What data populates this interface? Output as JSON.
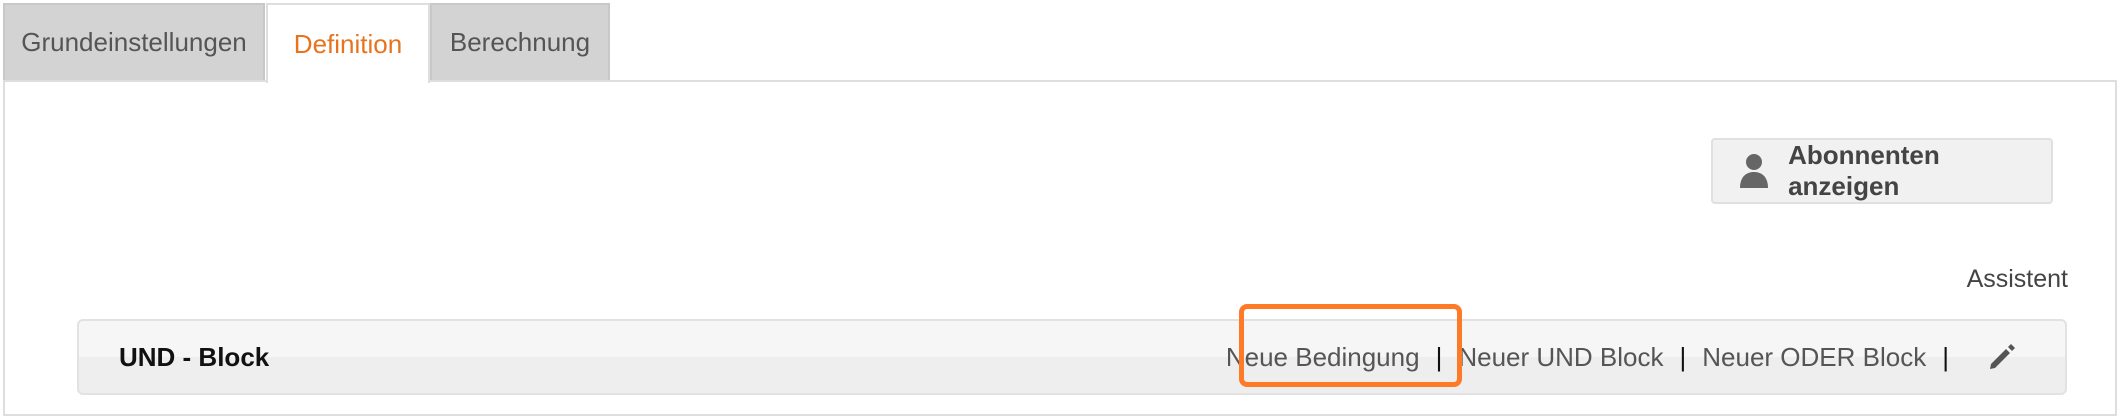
{
  "tabs": [
    {
      "label": "Grundeinstellungen",
      "active": false
    },
    {
      "label": "Definition",
      "active": true
    },
    {
      "label": "Berechnung",
      "active": false
    }
  ],
  "toolbar": {
    "show_subscribers_label": "Abonnenten anzeigen",
    "show_subscribers_icon": "user-icon",
    "assistant_label": "Assistent"
  },
  "block": {
    "title": "UND - Block",
    "actions": {
      "new_condition": "Neue Bedingung",
      "new_and_block": "Neuer UND Block",
      "new_or_block": "Neuer ODER Block",
      "separator": "|",
      "edit_icon": "pencil-icon"
    }
  },
  "colors": {
    "accent": "#e8731e",
    "highlight": "#ff7a26",
    "tab_inactive_bg": "#d3d3d3"
  }
}
